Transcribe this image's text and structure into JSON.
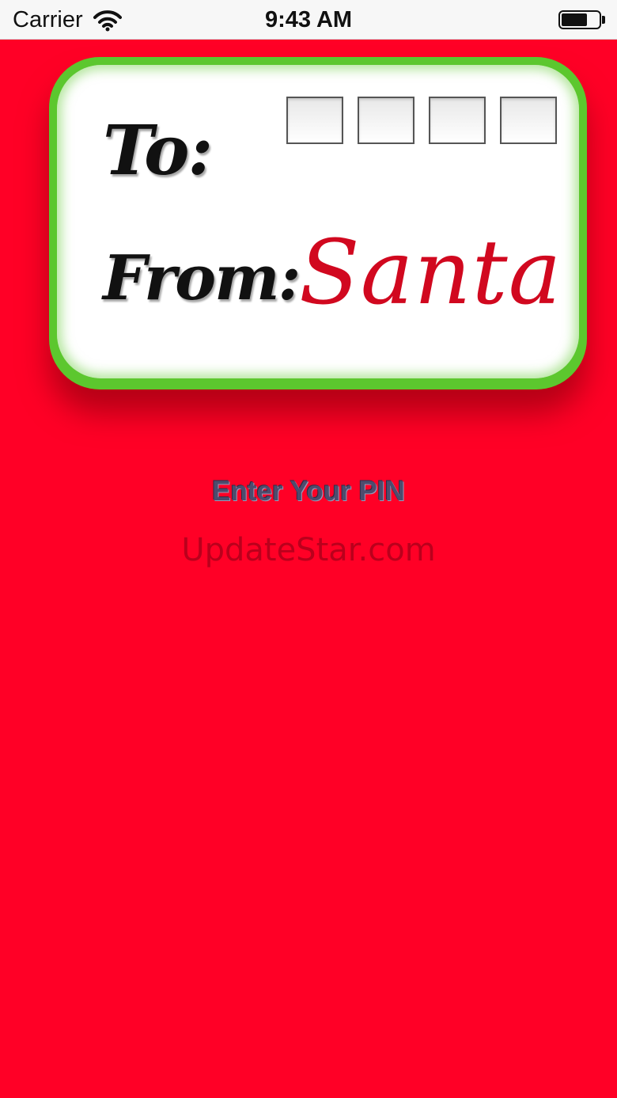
{
  "status_bar": {
    "carrier": "Carrier",
    "time": "9:43 AM",
    "battery_level": 0.7,
    "icons": [
      "wifi-icon",
      "battery-icon"
    ]
  },
  "gift_tag": {
    "to_label": "To:",
    "from_label": "From:",
    "from_value": "Santa",
    "pin_box_count": 4,
    "colors": {
      "border": "#5cc72e",
      "background": "#ffffff",
      "santa_text": "#d1081f"
    }
  },
  "pin_prompt": "Enter Your PIN",
  "watermark": "UpdateStar.com",
  "colors": {
    "background": "#ff0026",
    "prompt_text": "#4d4c6e"
  }
}
